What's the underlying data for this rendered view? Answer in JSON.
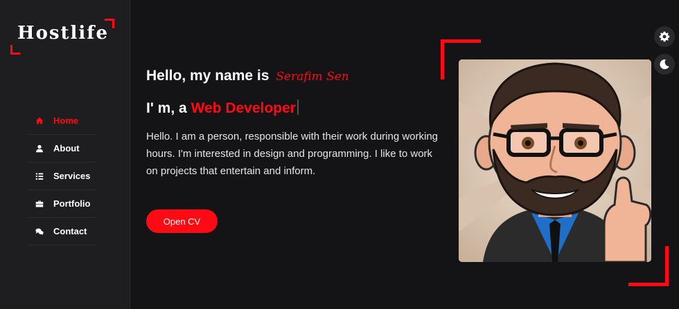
{
  "logo": {
    "text": "Hostlife"
  },
  "nav": {
    "items": [
      {
        "label": "Home",
        "icon": "home-icon",
        "active": true
      },
      {
        "label": "About",
        "icon": "user-icon",
        "active": false
      },
      {
        "label": "Services",
        "icon": "list-icon",
        "active": false
      },
      {
        "label": "Portfolio",
        "icon": "briefcase-icon",
        "active": false
      },
      {
        "label": "Contact",
        "icon": "comments-icon",
        "active": false
      }
    ]
  },
  "intro": {
    "greeting": "Hello, my name is",
    "name": "Serafim Sen",
    "role_prefix": "I' m, a",
    "role": "Web Developer",
    "description": "Hello. I am a person, responsible with their work during working hours. I'm interested in design and programming. I like to work on projects that entertain and inform.",
    "cv_button": "Open CV"
  },
  "controls": {
    "settings_icon": "gear-icon",
    "theme_icon": "moon-icon"
  },
  "colors": {
    "accent": "#ff0a14",
    "background": "#141315",
    "sidebar": "#1e1e20"
  }
}
